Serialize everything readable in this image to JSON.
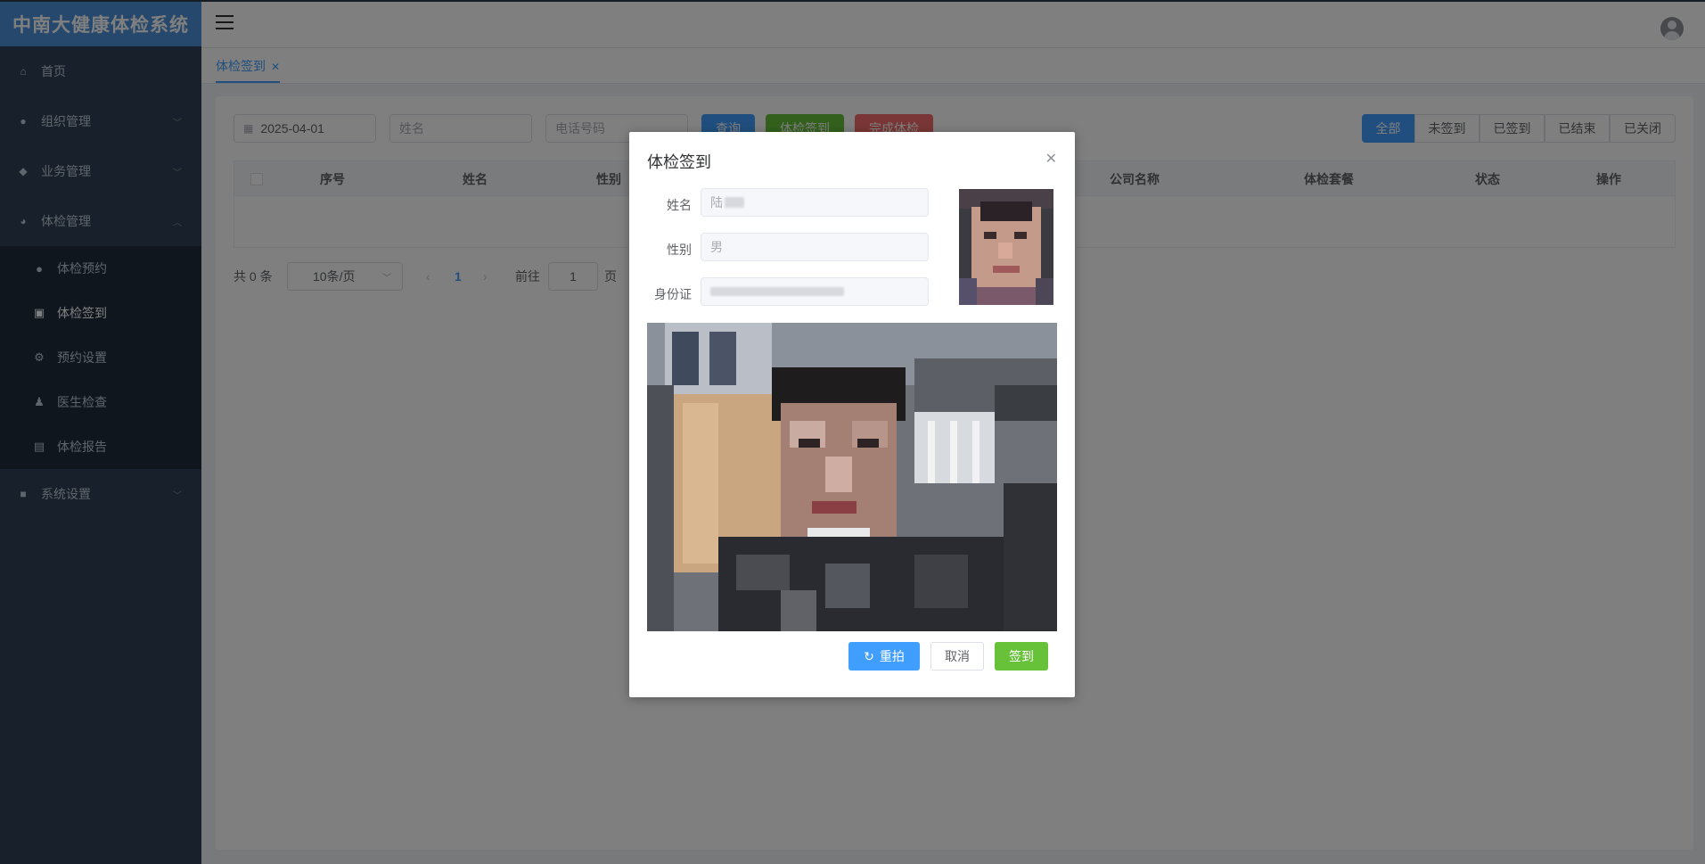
{
  "app": {
    "logo_text": "中南大健康体检系统"
  },
  "sidebar": {
    "items": [
      {
        "label": "首页",
        "icon": "home-icon"
      },
      {
        "label": "组织管理",
        "icon": "users-icon"
      },
      {
        "label": "业务管理",
        "icon": "tag-icon"
      },
      {
        "label": "体检管理",
        "icon": "pie-icon"
      }
    ],
    "sub_items": [
      {
        "label": "体检预约",
        "icon": "people-icon"
      },
      {
        "label": "体检签到",
        "icon": "checkin-icon"
      },
      {
        "label": "预约设置",
        "icon": "gear-icon"
      },
      {
        "label": "医生检查",
        "icon": "doctor-icon"
      },
      {
        "label": "体检报告",
        "icon": "report-icon"
      }
    ],
    "system": {
      "label": "系统设置",
      "icon": "briefcase-icon"
    }
  },
  "tabs": [
    {
      "label": "体检签到"
    }
  ],
  "filters": {
    "date": "2025-04-01",
    "name_placeholder": "姓名",
    "phone_placeholder": "电话号码",
    "query_label": "查询",
    "checkin_label": "体检签到",
    "complete_label": "完成体检"
  },
  "status_tabs": [
    "全部",
    "未签到",
    "已签到",
    "已结束",
    "已关闭"
  ],
  "table": {
    "headers": [
      "序号",
      "姓名",
      "性别",
      "公司名称",
      "体检套餐",
      "状态",
      "操作"
    ]
  },
  "pagination": {
    "total_text": "共 0 条",
    "page_size": "10条/页",
    "current_page": "1",
    "goto_label": "前往",
    "goto_value": "1",
    "page_unit": "页"
  },
  "dialog": {
    "title": "体检签到",
    "name_label": "姓名",
    "name_value": "陆",
    "gender_label": "性别",
    "gender_value": "男",
    "id_label": "身份证",
    "retake_label": "重拍",
    "cancel_label": "取消",
    "sign_label": "签到"
  },
  "colors": {
    "primary": "#409eff",
    "success": "#67c23a",
    "danger": "#f56c6c",
    "sidebar_bg": "#304156",
    "logo_bg": "#4a90d9"
  }
}
